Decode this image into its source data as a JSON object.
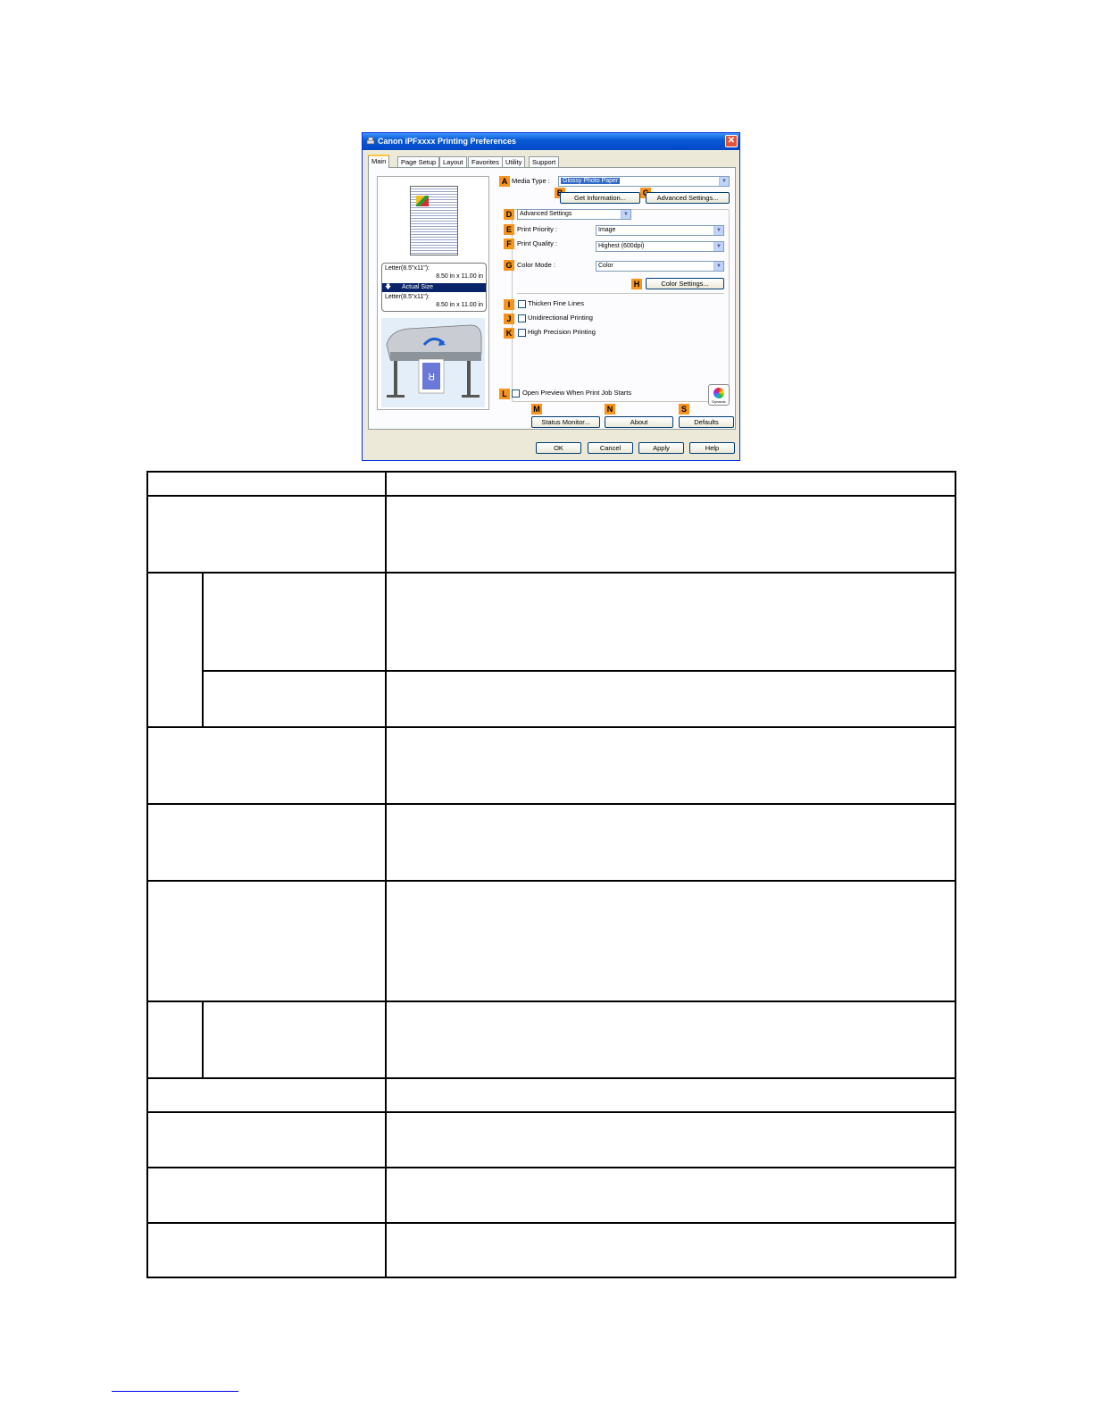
{
  "dialog": {
    "title": "Canon iPFxxxx Printing Preferences",
    "close_glyph": "✕",
    "tabs": [
      "Main",
      "Page Setup",
      "Layout",
      "Favorites",
      "Utility",
      "Support"
    ],
    "preview": {
      "paper_line1": "Letter(8.5\"x11\"):",
      "paper_line2": "8.50 in x 11.00 in",
      "mode": "Actual Size",
      "output_line1": "Letter(8.5\"x11\"):",
      "output_line2": "8.50 in x 11.00 in",
      "arrow_glyph": "🡇"
    },
    "media_type": {
      "badge": "A",
      "label": "Media Type :",
      "value": "Glossy Photo Paper"
    },
    "get_info": {
      "badge": "B",
      "label": "Get Information..."
    },
    "advanced_settings_btn": {
      "badge": "C",
      "label": "Advanced Settings..."
    },
    "mode_select": {
      "badge": "D",
      "value": "Advanced Settings"
    },
    "print_priority": {
      "badge": "E",
      "label": "Print Priority :",
      "value": "Image"
    },
    "print_quality": {
      "badge": "F",
      "label": "Print Quality :",
      "value": "Highest (600dpi)"
    },
    "color_mode": {
      "badge": "G",
      "label": "Color Mode :",
      "value": "Color"
    },
    "color_settings": {
      "badge": "H",
      "label": "Color Settings..."
    },
    "thicken": {
      "badge": "I",
      "label": "Thicken Fine Lines"
    },
    "unidirectional": {
      "badge": "J",
      "label": "Unidirectional Printing"
    },
    "high_precision": {
      "badge": "K",
      "label": "High Precision Printing"
    },
    "open_preview": {
      "badge": "L",
      "label": "Open Preview When Print Job Starts"
    },
    "dynamic_label": "Dynamic",
    "status_monitor": {
      "badge": "M",
      "label": "Status Monitor..."
    },
    "about": {
      "badge": "N",
      "label": "About"
    },
    "defaults": {
      "badge": "S",
      "label": "Defaults"
    },
    "ok": "OK",
    "cancel": "Cancel",
    "apply": "Apply",
    "help": "Help"
  },
  "icons": {
    "dropdown": "▼"
  }
}
